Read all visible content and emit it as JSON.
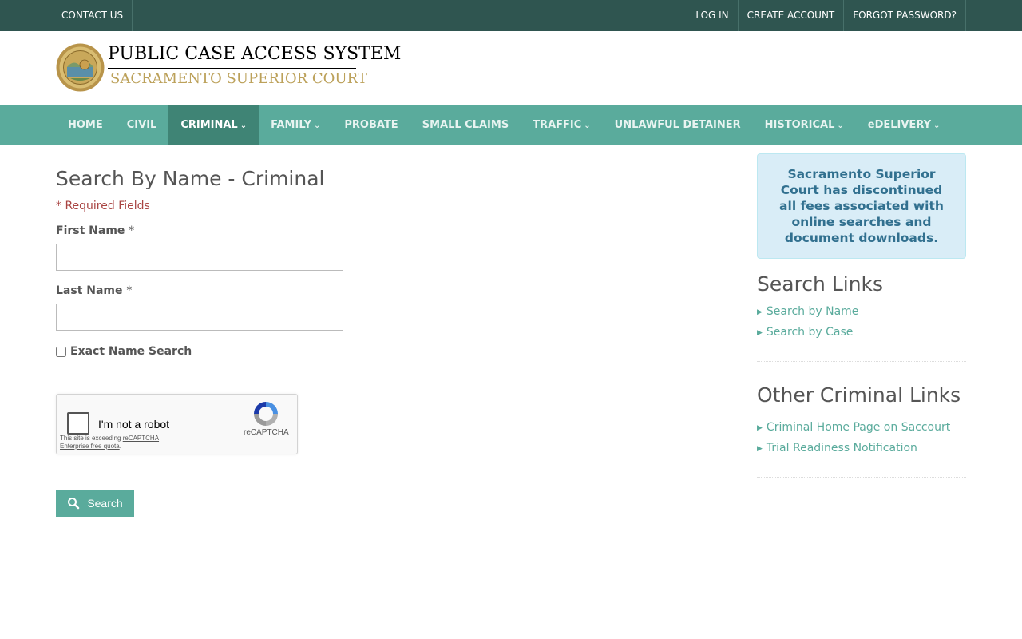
{
  "topbar": {
    "left_links": [
      "CONTACT US"
    ],
    "right_links": [
      "LOG IN",
      "CREATE ACCOUNT",
      "FORGOT PASSWORD?"
    ]
  },
  "header": {
    "title": "PUBLIC CASE ACCESS SYSTEM",
    "subtitle": "SACRAMENTO SUPERIOR COURT"
  },
  "nav": {
    "items": [
      {
        "label": "HOME",
        "dropdown": false
      },
      {
        "label": "CIVIL",
        "dropdown": false
      },
      {
        "label": "CRIMINAL",
        "dropdown": true,
        "active": true
      },
      {
        "label": "FAMILY",
        "dropdown": true
      },
      {
        "label": "PROBATE",
        "dropdown": false
      },
      {
        "label": "SMALL CLAIMS",
        "dropdown": false
      },
      {
        "label": "TRAFFIC",
        "dropdown": true
      },
      {
        "label": "UNLAWFUL DETAINER",
        "dropdown": false
      },
      {
        "label": "HISTORICAL",
        "dropdown": true
      },
      {
        "label": "eDELIVERY",
        "dropdown": true
      }
    ]
  },
  "main": {
    "title": "Search By Name - Criminal",
    "required_note": "* Required Fields",
    "first_name_label": "First Name",
    "last_name_label": "Last Name",
    "required_star": "*",
    "first_name_value": "",
    "last_name_value": "",
    "exact_label": "Exact Name Search",
    "exact_checked": false,
    "captcha": {
      "checkbox_label": "I'm not a robot",
      "brand": "reCAPTCHA",
      "quota_prefix": "This site is exceeding ",
      "quota_link": "reCAPTCHA Enterprise free quota",
      "quota_suffix": "."
    },
    "search_button": "Search"
  },
  "sidebar": {
    "notice": "Sacramento Superior Court has discontinued all fees associated with online searches and document downloads.",
    "search_links_heading": "Search Links",
    "search_links": [
      "Search by Name",
      "Search by Case"
    ],
    "other_links_heading": "Other Criminal Links",
    "other_links": [
      "Criminal Home Page on Saccourt",
      "Trial Readiness Notification"
    ]
  },
  "colors": {
    "topbar": "#2f5550",
    "nav": "#5aab9c",
    "nav_active": "#3f8475",
    "accent": "#5aab9c",
    "notice_bg": "#d9edf7",
    "notice_text": "#31708f",
    "required": "#a94442",
    "logo_gold": "#bca15a"
  }
}
